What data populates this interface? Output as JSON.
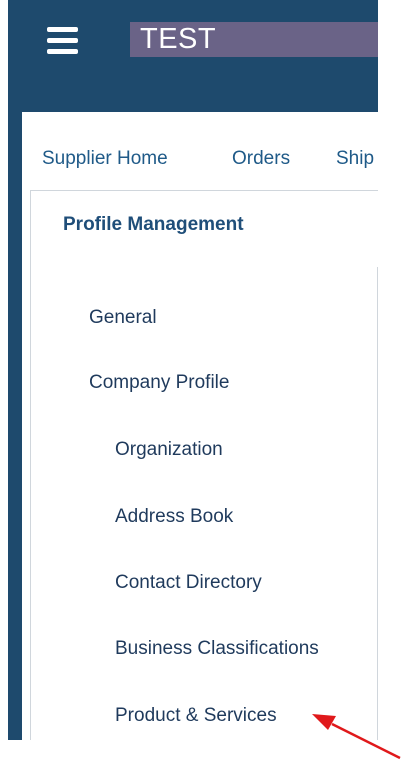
{
  "topbar": {
    "menu_icon": "hamburger-menu-icon",
    "title": "TEST",
    "title_bg": "#6a6387",
    "bar_color": "#1e4a6d"
  },
  "nav": {
    "tabs": [
      {
        "label": "Supplier Home"
      },
      {
        "label": "Orders"
      },
      {
        "label": "Ship"
      }
    ]
  },
  "sidebar": {
    "title": "Profile Management",
    "items": [
      {
        "label": "General"
      },
      {
        "label": "Company Profile"
      },
      {
        "label": "Organization"
      },
      {
        "label": "Address Book"
      },
      {
        "label": "Contact Directory"
      },
      {
        "label": "Business Classifications"
      },
      {
        "label": "Product & Services"
      }
    ]
  },
  "annotation": {
    "arrow_color": "#e0191b"
  }
}
